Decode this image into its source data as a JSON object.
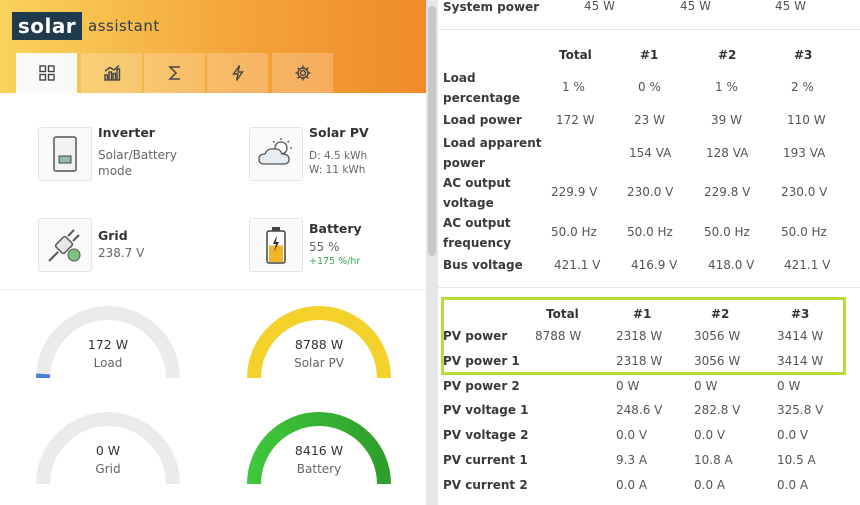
{
  "app": {
    "logo_mark": "solar",
    "logo_word": "assistant"
  },
  "tabs": [
    {
      "icon": "dashboard-grid-icon",
      "active": true
    },
    {
      "icon": "chart-bars-icon",
      "active": false
    },
    {
      "icon": "sigma-icon",
      "active": false
    },
    {
      "icon": "lightning-icon",
      "active": false
    },
    {
      "icon": "gear-icon",
      "active": false
    }
  ],
  "devices": {
    "inverter": {
      "title": "Inverter",
      "line1": "Solar/Battery",
      "line2": "mode"
    },
    "solar_pv": {
      "title": "Solar PV",
      "line1": "D: 4.5 kWh",
      "line2": "W: 11 kWh"
    },
    "grid": {
      "title": "Grid",
      "line1": "238.7 V"
    },
    "battery": {
      "title": "Battery",
      "line1": "55 %",
      "line2": "+175 %/hr",
      "level_percent": 55
    }
  },
  "gauges": {
    "load": {
      "value": "172 W",
      "label": "Load",
      "fill_fraction": 0.02,
      "color": "#4a7fd6"
    },
    "solar_pv": {
      "value": "8788 W",
      "label": "Solar PV",
      "fill_fraction": 1.0,
      "color": "#f4d12b"
    },
    "grid": {
      "value": "0 W",
      "label": "Grid",
      "fill_fraction": 0.0,
      "color": "#cccccc"
    },
    "battery": {
      "value": "8416 W",
      "label": "Battery",
      "fill_fraction": 1.0,
      "color": "#3db83a"
    }
  },
  "system_power": {
    "label": "System power",
    "values": [
      "45 W",
      "45 W",
      "45 W"
    ]
  },
  "load_table": {
    "headers": [
      "Total",
      "#1",
      "#2",
      "#3"
    ],
    "rows": [
      {
        "label_1": "Load",
        "label_2": "percentage",
        "values": [
          "1 %",
          "0 %",
          "1 %",
          "2 %"
        ]
      },
      {
        "label_1": "Load power",
        "values": [
          "172 W",
          "23 W",
          "39 W",
          "110 W"
        ]
      },
      {
        "label_1": "Load apparent",
        "label_2": "power",
        "values": [
          "",
          "154 VA",
          "128 VA",
          "193 VA"
        ]
      },
      {
        "label_1": "AC output",
        "label_2": "voltage",
        "values": [
          "229.9 V",
          "230.0 V",
          "229.8 V",
          "230.0 V"
        ]
      },
      {
        "label_1": "AC output",
        "label_2": "frequency",
        "values": [
          "50.0 Hz",
          "50.0 Hz",
          "50.0 Hz",
          "50.0 Hz"
        ]
      },
      {
        "label_1": "Bus voltage",
        "values": [
          "421.1 V",
          "416.9 V",
          "418.0 V",
          "421.1 V"
        ]
      }
    ]
  },
  "pv_table": {
    "headers": [
      "Total",
      "#1",
      "#2",
      "#3"
    ],
    "rows": [
      {
        "label": "PV power",
        "values": [
          "8788 W",
          "2318 W",
          "3056 W",
          "3414 W"
        ]
      },
      {
        "label": "PV power 1",
        "values": [
          "",
          "2318 W",
          "3056 W",
          "3414 W"
        ]
      },
      {
        "label": "PV power 2",
        "values": [
          "",
          "0 W",
          "0 W",
          "0 W"
        ]
      },
      {
        "label": "PV voltage 1",
        "values": [
          "",
          "248.6 V",
          "282.8 V",
          "325.8 V"
        ]
      },
      {
        "label": "PV voltage 2",
        "values": [
          "",
          "0.0 V",
          "0.0 V",
          "0.0 V"
        ]
      },
      {
        "label": "PV current 1",
        "values": [
          "",
          "9.3 A",
          "10.8 A",
          "10.5 A"
        ]
      },
      {
        "label": "PV current 2",
        "values": [
          "",
          "0.0 A",
          "0.0 A",
          "0.0 A"
        ]
      }
    ]
  },
  "colors": {
    "highlight_border": "#b7dd3b",
    "header_start": "#f8d35c",
    "header_end": "#ef8a2b",
    "logo_bg": "#1f3a4d"
  }
}
